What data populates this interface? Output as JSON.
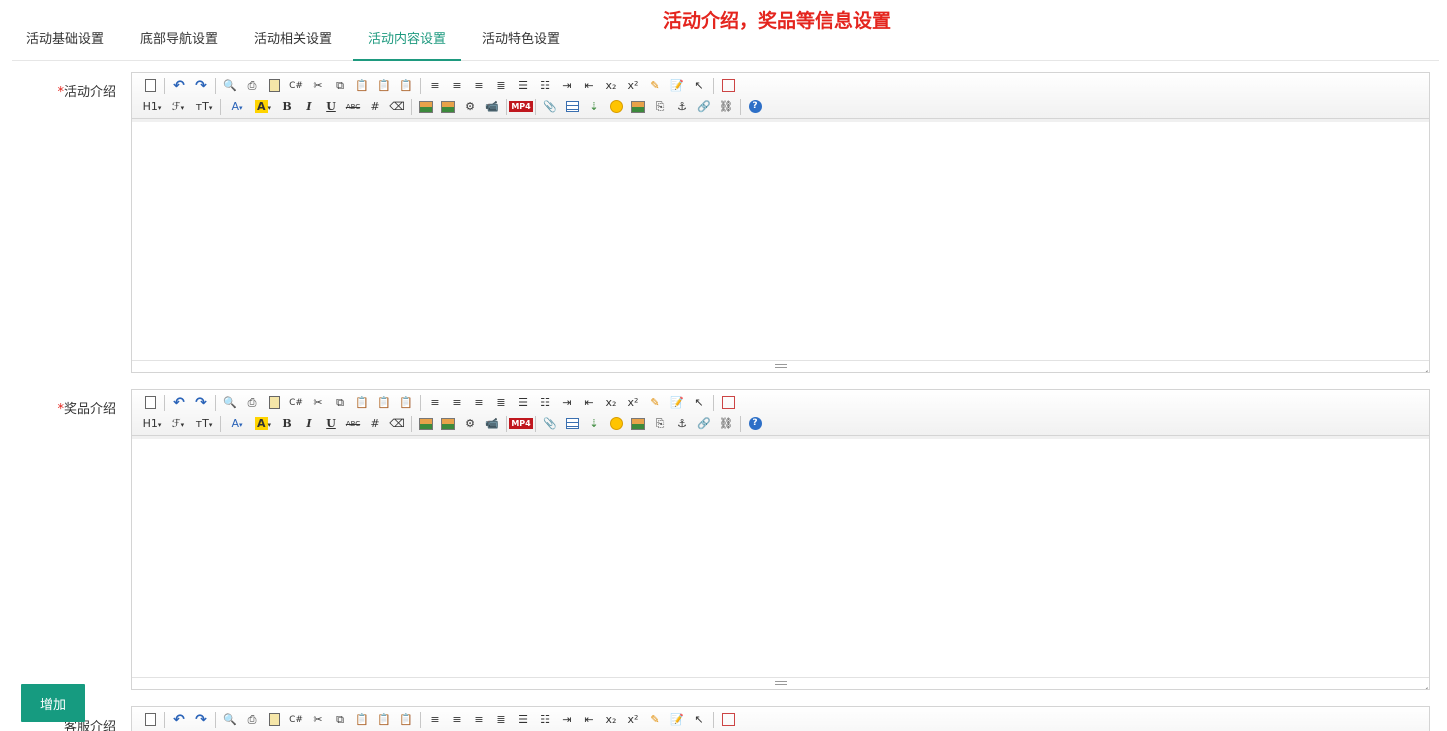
{
  "annotation": "活动介绍，奖品等信息设置",
  "tabs": [
    {
      "label": "活动基础设置"
    },
    {
      "label": "底部导航设置"
    },
    {
      "label": "活动相关设置"
    },
    {
      "label": "活动内容设置"
    },
    {
      "label": "活动特色设置"
    }
  ],
  "fields": [
    {
      "required": "*",
      "label": "活动介绍"
    },
    {
      "required": "*",
      "label": "奖品介绍"
    },
    {
      "required": "",
      "label": "客服介绍"
    }
  ],
  "toolbar_glyphs": {
    "heading": "H1",
    "font_family": "ℱ",
    "font_size": "тT",
    "font_color": "A",
    "highlight": "A",
    "bold": "B",
    "italic": "I",
    "underline": "U",
    "strike": "ABC",
    "subscript": "x₂",
    "superscript": "x²",
    "mp4": "MP4",
    "help": "?",
    "dropdown": "▾"
  },
  "add_button": {
    "label": "增加"
  },
  "colors": {
    "accent": "#1e9a7f",
    "annotation": "#e4251e",
    "required": "#e4251e",
    "button": "#169b80"
  }
}
